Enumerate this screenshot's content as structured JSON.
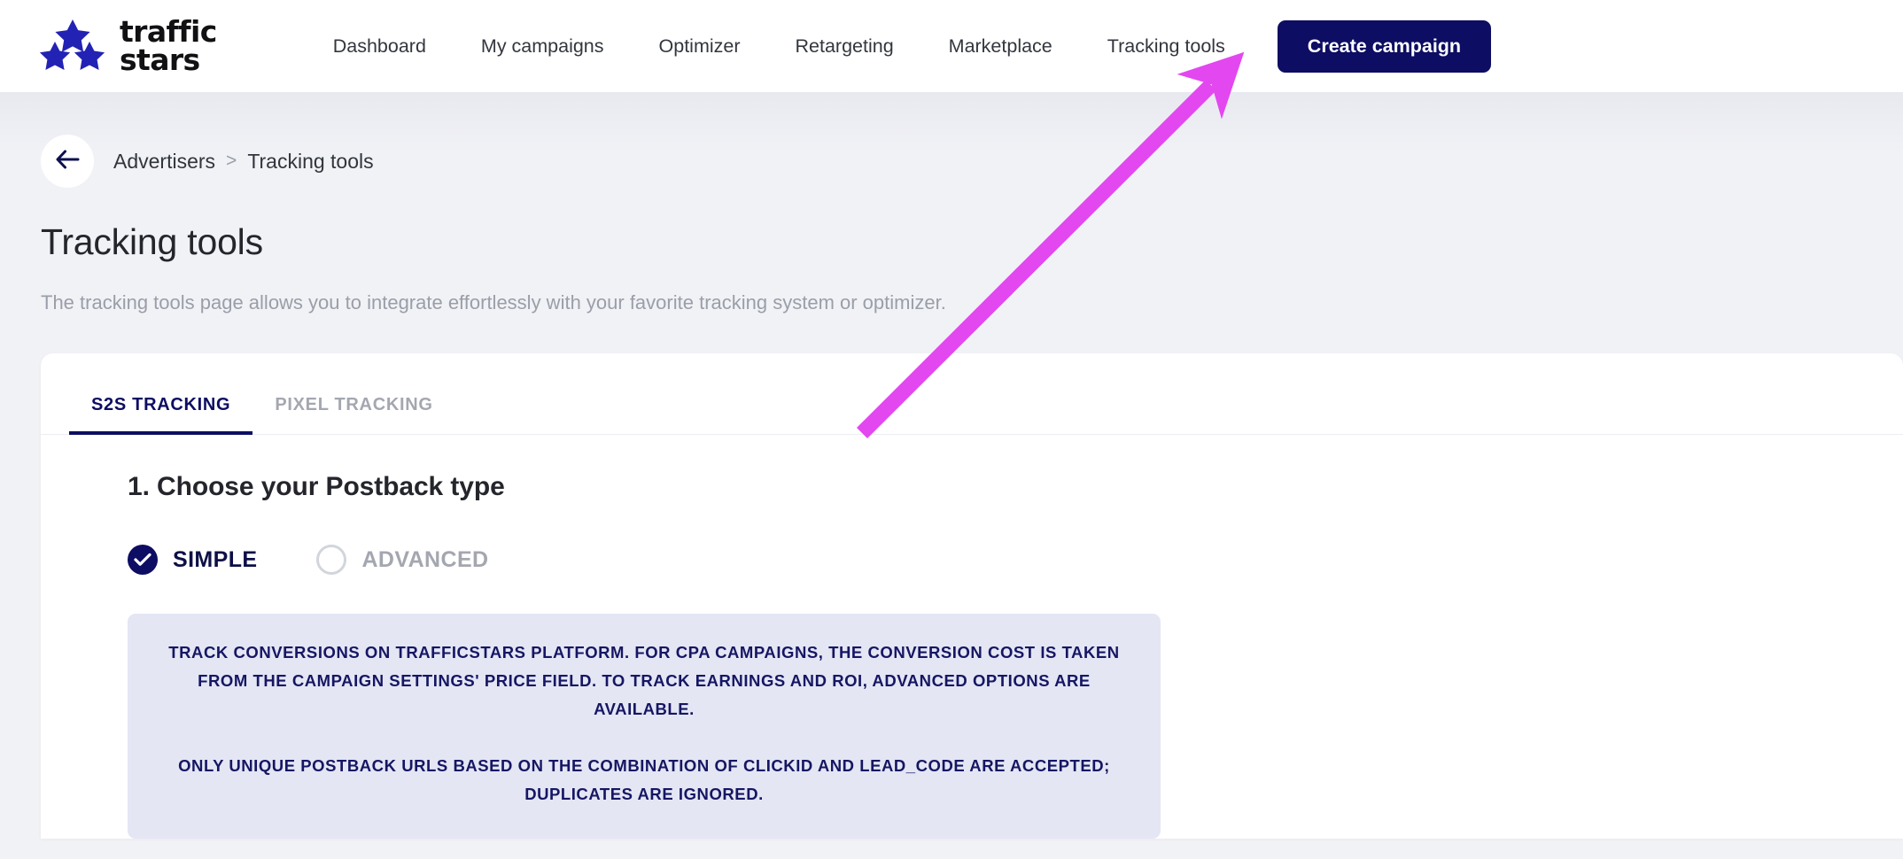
{
  "header": {
    "logo": {
      "line1": "traffic",
      "line2": "stars",
      "icon": "three-stars-icon"
    },
    "nav_items": [
      {
        "label": "Dashboard"
      },
      {
        "label": "My campaigns"
      },
      {
        "label": "Optimizer"
      },
      {
        "label": "Retargeting"
      },
      {
        "label": "Marketplace"
      },
      {
        "label": "Tracking tools"
      }
    ],
    "cta_label": "Create campaign"
  },
  "breadcrumb": {
    "back_icon": "arrow-left-icon",
    "separator": ">",
    "items": [
      {
        "label": "Advertisers"
      },
      {
        "label": "Tracking tools"
      }
    ]
  },
  "page": {
    "title": "Tracking tools",
    "description": "The tracking tools page allows you to integrate effortlessly with your favorite tracking system or optimizer."
  },
  "tabs": [
    {
      "label": "S2S TRACKING",
      "active": true
    },
    {
      "label": "PIXEL TRACKING",
      "active": false
    }
  ],
  "postback": {
    "section_title": "1. Choose your Postback type",
    "options": [
      {
        "label": "SIMPLE",
        "selected": true,
        "icon": "check-circle-icon"
      },
      {
        "label": "ADVANCED",
        "selected": false,
        "icon": "circle-icon"
      }
    ],
    "info_paragraph_1": "TRACK CONVERSIONS ON TRAFFICSTARS PLATFORM. FOR CPA CAMPAIGNS, THE CONVERSION COST IS TAKEN FROM THE CAMPAIGN SETTINGS' PRICE FIELD. TO TRACK EARNINGS AND ROI, ADVANCED OPTIONS ARE AVAILABLE.",
    "info_paragraph_2": "ONLY UNIQUE POSTBACK URLS BASED ON THE COMBINATION OF CLICKID AND LEAD_CODE ARE ACCEPTED; DUPLICATES ARE IGNORED."
  },
  "annotation": {
    "type": "arrow",
    "color": "#e347f0",
    "points_to": "Tracking tools"
  },
  "colors": {
    "brand_navy": "#0d0d63",
    "logo_star_blue": "#2222b4",
    "page_background": "#f1f2f6",
    "info_box_background": "#e4e6f4",
    "muted_text": "#9a9ea8"
  }
}
